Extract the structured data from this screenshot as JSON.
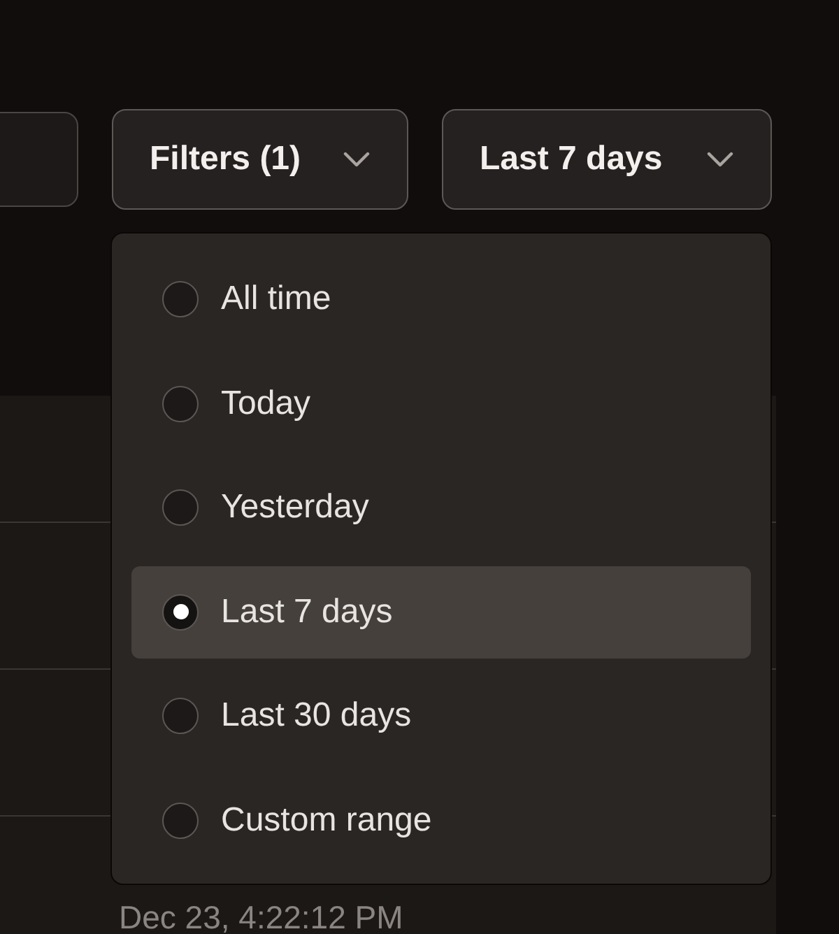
{
  "toolbar": {
    "filters_button": {
      "label": "Filters (1)"
    },
    "range_button": {
      "label": "Last 7 days"
    }
  },
  "table": {
    "rows": [
      {
        "date": ""
      },
      {
        "date": ""
      },
      {
        "date": ""
      },
      {
        "date": "Dec 23, 4:22:12 PM"
      }
    ]
  },
  "range_menu": {
    "options": [
      {
        "label": "All time",
        "selected": false
      },
      {
        "label": "Today",
        "selected": false
      },
      {
        "label": "Yesterday",
        "selected": false
      },
      {
        "label": "Last 7 days",
        "selected": true
      },
      {
        "label": "Last 30 days",
        "selected": false
      },
      {
        "label": "Custom range",
        "selected": false
      }
    ]
  }
}
